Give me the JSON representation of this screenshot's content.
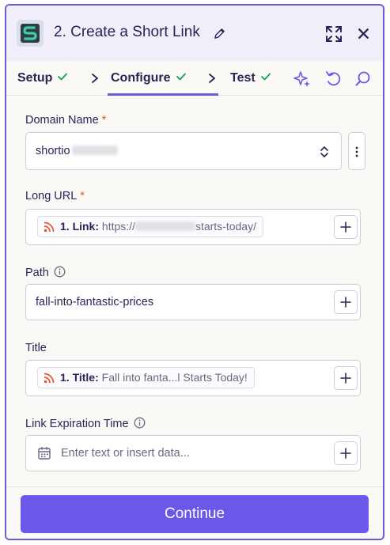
{
  "header": {
    "title": "2. Create a Short Link"
  },
  "tabs": [
    {
      "label": "Setup",
      "completed": true
    },
    {
      "label": "Configure",
      "completed": true,
      "active": true
    },
    {
      "label": "Test",
      "completed": true
    }
  ],
  "toolbar_icons": [
    "sparkle-icon",
    "undo-icon",
    "search-icon"
  ],
  "fields": {
    "domain": {
      "label": "Domain Name",
      "required": "*",
      "value": "shortio"
    },
    "long_url": {
      "label": "Long URL",
      "required": "*",
      "pill_key": "1. Link:",
      "pill_value_start": "https://",
      "pill_value_end": "starts-today/"
    },
    "path": {
      "label": "Path",
      "value": "fall-into-fantastic-prices"
    },
    "title": {
      "label": "Title",
      "pill_key": "1. Title:",
      "pill_value": "Fall into fanta...l Starts Today!"
    },
    "link_expiration": {
      "label": "Link Expiration Time",
      "placeholder": "Enter text or insert data..."
    }
  },
  "footer": {
    "continue_label": "Continue"
  },
  "colors": {
    "accent": "#6b58e8",
    "required": "#e4572e",
    "check": "#1d9b62",
    "rss": "#e4572e"
  }
}
